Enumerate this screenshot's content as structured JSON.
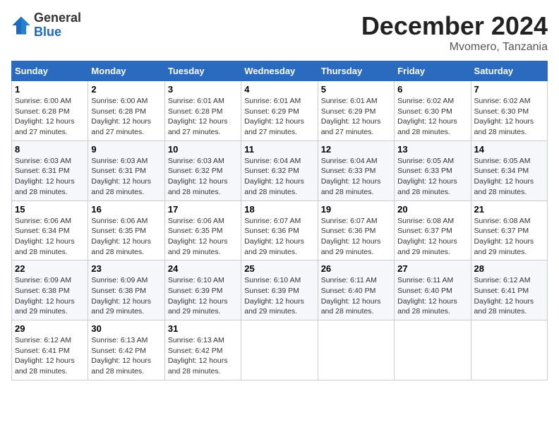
{
  "header": {
    "logo_general": "General",
    "logo_blue": "Blue",
    "month_title": "December 2024",
    "location": "Mvomero, Tanzania"
  },
  "weekdays": [
    "Sunday",
    "Monday",
    "Tuesday",
    "Wednesday",
    "Thursday",
    "Friday",
    "Saturday"
  ],
  "weeks": [
    [
      {
        "day": "1",
        "sunrise": "6:00 AM",
        "sunset": "6:28 PM",
        "daylight": "12 hours and 27 minutes."
      },
      {
        "day": "2",
        "sunrise": "6:00 AM",
        "sunset": "6:28 PM",
        "daylight": "12 hours and 27 minutes."
      },
      {
        "day": "3",
        "sunrise": "6:01 AM",
        "sunset": "6:28 PM",
        "daylight": "12 hours and 27 minutes."
      },
      {
        "day": "4",
        "sunrise": "6:01 AM",
        "sunset": "6:29 PM",
        "daylight": "12 hours and 27 minutes."
      },
      {
        "day": "5",
        "sunrise": "6:01 AM",
        "sunset": "6:29 PM",
        "daylight": "12 hours and 27 minutes."
      },
      {
        "day": "6",
        "sunrise": "6:02 AM",
        "sunset": "6:30 PM",
        "daylight": "12 hours and 28 minutes."
      },
      {
        "day": "7",
        "sunrise": "6:02 AM",
        "sunset": "6:30 PM",
        "daylight": "12 hours and 28 minutes."
      }
    ],
    [
      {
        "day": "8",
        "sunrise": "6:03 AM",
        "sunset": "6:31 PM",
        "daylight": "12 hours and 28 minutes."
      },
      {
        "day": "9",
        "sunrise": "6:03 AM",
        "sunset": "6:31 PM",
        "daylight": "12 hours and 28 minutes."
      },
      {
        "day": "10",
        "sunrise": "6:03 AM",
        "sunset": "6:32 PM",
        "daylight": "12 hours and 28 minutes."
      },
      {
        "day": "11",
        "sunrise": "6:04 AM",
        "sunset": "6:32 PM",
        "daylight": "12 hours and 28 minutes."
      },
      {
        "day": "12",
        "sunrise": "6:04 AM",
        "sunset": "6:33 PM",
        "daylight": "12 hours and 28 minutes."
      },
      {
        "day": "13",
        "sunrise": "6:05 AM",
        "sunset": "6:33 PM",
        "daylight": "12 hours and 28 minutes."
      },
      {
        "day": "14",
        "sunrise": "6:05 AM",
        "sunset": "6:34 PM",
        "daylight": "12 hours and 28 minutes."
      }
    ],
    [
      {
        "day": "15",
        "sunrise": "6:06 AM",
        "sunset": "6:34 PM",
        "daylight": "12 hours and 28 minutes."
      },
      {
        "day": "16",
        "sunrise": "6:06 AM",
        "sunset": "6:35 PM",
        "daylight": "12 hours and 28 minutes."
      },
      {
        "day": "17",
        "sunrise": "6:06 AM",
        "sunset": "6:35 PM",
        "daylight": "12 hours and 29 minutes."
      },
      {
        "day": "18",
        "sunrise": "6:07 AM",
        "sunset": "6:36 PM",
        "daylight": "12 hours and 29 minutes."
      },
      {
        "day": "19",
        "sunrise": "6:07 AM",
        "sunset": "6:36 PM",
        "daylight": "12 hours and 29 minutes."
      },
      {
        "day": "20",
        "sunrise": "6:08 AM",
        "sunset": "6:37 PM",
        "daylight": "12 hours and 29 minutes."
      },
      {
        "day": "21",
        "sunrise": "6:08 AM",
        "sunset": "6:37 PM",
        "daylight": "12 hours and 29 minutes."
      }
    ],
    [
      {
        "day": "22",
        "sunrise": "6:09 AM",
        "sunset": "6:38 PM",
        "daylight": "12 hours and 29 minutes."
      },
      {
        "day": "23",
        "sunrise": "6:09 AM",
        "sunset": "6:38 PM",
        "daylight": "12 hours and 29 minutes."
      },
      {
        "day": "24",
        "sunrise": "6:10 AM",
        "sunset": "6:39 PM",
        "daylight": "12 hours and 29 minutes."
      },
      {
        "day": "25",
        "sunrise": "6:10 AM",
        "sunset": "6:39 PM",
        "daylight": "12 hours and 29 minutes."
      },
      {
        "day": "26",
        "sunrise": "6:11 AM",
        "sunset": "6:40 PM",
        "daylight": "12 hours and 28 minutes."
      },
      {
        "day": "27",
        "sunrise": "6:11 AM",
        "sunset": "6:40 PM",
        "daylight": "12 hours and 28 minutes."
      },
      {
        "day": "28",
        "sunrise": "6:12 AM",
        "sunset": "6:41 PM",
        "daylight": "12 hours and 28 minutes."
      }
    ],
    [
      {
        "day": "29",
        "sunrise": "6:12 AM",
        "sunset": "6:41 PM",
        "daylight": "12 hours and 28 minutes."
      },
      {
        "day": "30",
        "sunrise": "6:13 AM",
        "sunset": "6:42 PM",
        "daylight": "12 hours and 28 minutes."
      },
      {
        "day": "31",
        "sunrise": "6:13 AM",
        "sunset": "6:42 PM",
        "daylight": "12 hours and 28 minutes."
      },
      null,
      null,
      null,
      null
    ]
  ],
  "labels": {
    "sunrise": "Sunrise:",
    "sunset": "Sunset:",
    "daylight": "Daylight:"
  }
}
